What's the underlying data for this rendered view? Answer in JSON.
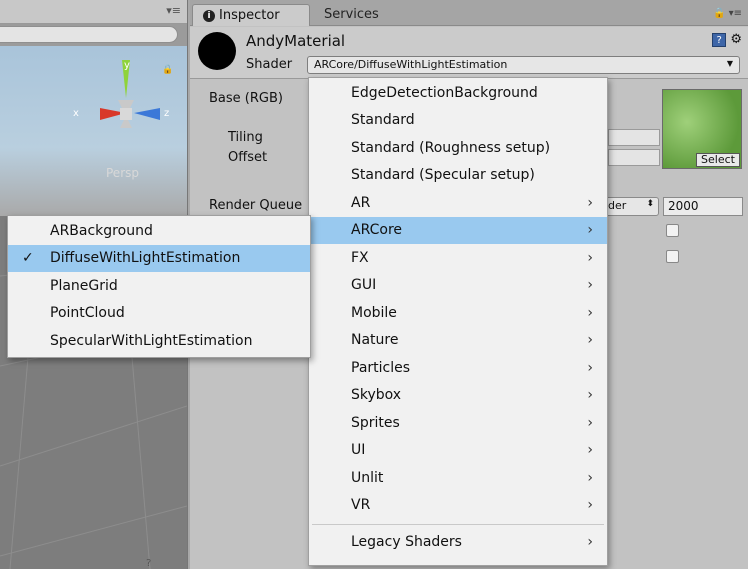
{
  "inspector": {
    "tabs": [
      {
        "label": "Inspector",
        "active": true
      },
      {
        "label": "Services",
        "active": false
      }
    ]
  },
  "material": {
    "name": "AndyMaterial",
    "shader_label": "Shader",
    "shader_value": "ARCore/DiffuseWithLightEstimation"
  },
  "properties": {
    "base_label": "Base (RGB)",
    "tiling_label": "Tiling",
    "offset_label": "Offset",
    "render_queue_label": "Render Queue",
    "render_queue_mode_partial": "der",
    "render_queue_value": "2000",
    "texture_select_label": "Select"
  },
  "scene": {
    "persp_label": "Persp",
    "gizmo_axes": {
      "y": "y",
      "x": "x",
      "z": "z"
    },
    "bottom_text": "?"
  },
  "shader_menu": {
    "items": [
      {
        "label": "EdgeDetectionBackground",
        "submenu": false
      },
      {
        "label": "Standard",
        "submenu": false
      },
      {
        "label": "Standard (Roughness setup)",
        "submenu": false
      },
      {
        "label": "Standard (Specular setup)",
        "submenu": false
      },
      {
        "label": "AR",
        "submenu": true
      },
      {
        "label": "ARCore",
        "submenu": true,
        "highlighted": true
      },
      {
        "label": "FX",
        "submenu": true
      },
      {
        "label": "GUI",
        "submenu": true
      },
      {
        "label": "Mobile",
        "submenu": true
      },
      {
        "label": "Nature",
        "submenu": true
      },
      {
        "label": "Particles",
        "submenu": true
      },
      {
        "label": "Skybox",
        "submenu": true
      },
      {
        "label": "Sprites",
        "submenu": true
      },
      {
        "label": "UI",
        "submenu": true
      },
      {
        "label": "Unlit",
        "submenu": true
      },
      {
        "label": "VR",
        "submenu": true
      }
    ],
    "legacy_item": {
      "label": "Legacy Shaders",
      "submenu": true
    }
  },
  "arcore_submenu": {
    "items": [
      {
        "label": "ARBackground",
        "checked": false
      },
      {
        "label": "DiffuseWithLightEstimation",
        "checked": true
      },
      {
        "label": "PlaneGrid",
        "checked": false
      },
      {
        "label": "PointCloud",
        "checked": false
      },
      {
        "label": "SpecularWithLightEstimation",
        "checked": false
      }
    ]
  },
  "colors": {
    "menu_highlight": "#99c9ef",
    "gizmo_y": "#8fd33a",
    "gizmo_x": "#d8382a",
    "gizmo_z": "#3b78d8",
    "texture_green": "#6fa64a"
  },
  "icons": {
    "chevron": "chevron-right-icon",
    "check": "checkmark-icon",
    "help": "help-book-icon",
    "settings": "gear-icon",
    "lock": "lock-icon",
    "tab_menu": "tab-menu-icon"
  }
}
